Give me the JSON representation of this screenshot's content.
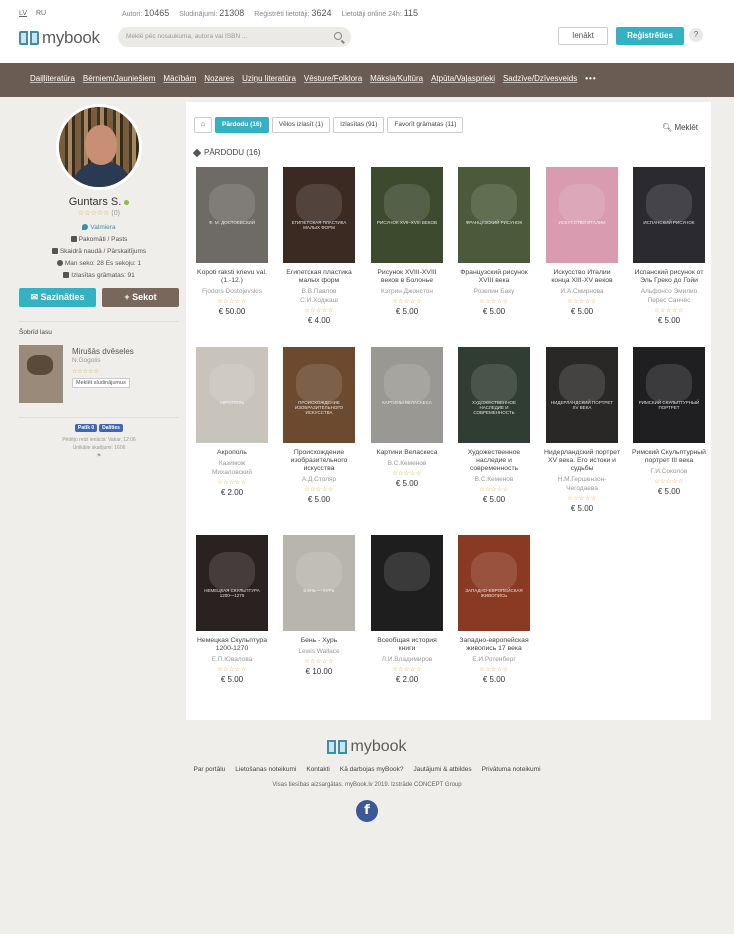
{
  "header": {
    "langs": [
      "LV",
      "RU"
    ],
    "stats": [
      {
        "label": "Autori:",
        "value": "10465"
      },
      {
        "label": "Sludinājumi:",
        "value": "21308"
      },
      {
        "label": "Reģistrēti lietotāji:",
        "value": "3624"
      },
      {
        "label": "Lietotāji online 24h:",
        "value": "115"
      }
    ],
    "logo": "mybook",
    "search_placeholder": "Meklē pēc nosaukuma, autora vai ISBN ...",
    "login": "Ienākt",
    "register": "Reģistrēties",
    "help": "?"
  },
  "nav": [
    "Daiļliteratūra",
    "Bērniem/Jauniešiem",
    "Mācībām",
    "Nozares",
    "Uziņu literatūra",
    "Vēsture/Folklora",
    "Māksla/Kultūra",
    "Atpūta/Vaļasprieki",
    "Sadzīve/Dzīvesveids",
    "•••"
  ],
  "profile": {
    "name": "Guntars S.",
    "stars": "☆☆☆☆☆",
    "rating_count": "(0)",
    "location": "Valmiera",
    "delivery": "Pakomāti / Pasts",
    "payment": "Skaidrā naudā / Pārskaitījums",
    "follow_stats": "Man seko: 28 Es sekoju: 1",
    "fav_stats": "Izlasītas grāmatas: 91",
    "contact_btn": "Sazināties",
    "follow_btn": "Sekot"
  },
  "today": {
    "heading": "Šobrīd lasu",
    "title": "Mirušās dvēseles",
    "author": "N.Gogolis",
    "stars": "☆☆☆☆☆",
    "btn": "Meklēt sludinājumus"
  },
  "social": {
    "fb_like": "Patīk 0",
    "fb_share": "Dalīties",
    "last_visit": "Pēdējo reizi ienācis: Vakar, 12:06",
    "unique_views": "Unikālie skatījumi: 1606",
    "flag": "⚑"
  },
  "tabs": [
    {
      "label": "⌂"
    },
    {
      "label": "Pārdodu (16)"
    },
    {
      "label": "Vēlos izlasīt (1)"
    },
    {
      "label": "Izlasītas (91)"
    },
    {
      "label": "Favorīt grāmatas (11)"
    }
  ],
  "search_link": "Meklēt",
  "section_title": "PĀRDODU (16)",
  "books": [
    {
      "title": "Kopoti raksti krievu val. (1.-12.)",
      "author": "Fjodors Dostojevskis",
      "stars": "☆☆☆☆☆",
      "price": "€ 50.00",
      "color": "#6e6b66",
      "cover_text": "Ф. М. ДОСТОЕВСКИЙ"
    },
    {
      "title": "Египетская пластика малых форм",
      "author": "В.В.Павлов\nС.И.Ходжаш",
      "stars": "☆☆☆☆☆",
      "price": "€ 4.00",
      "color": "#3a2a22",
      "cover_text": "ЕГИПЕТСКАЯ ПЛАСТИКА МАЛЫХ ФОРМ"
    },
    {
      "title": "Рисунок XVIII-XVIII веков в Болонье",
      "author": "Кэтрин Джонстон",
      "stars": "☆☆☆☆☆",
      "price": "€ 5.00",
      "color": "#3d4a2e",
      "cover_text": "РИСУНОК XVII–XVIII ВЕКОВ"
    },
    {
      "title": "Французский рисунок XVIII века",
      "author": "Розелин Баку",
      "stars": "☆☆☆☆☆",
      "price": "€ 5.00",
      "color": "#4a5a3a",
      "cover_text": "ФРАНЦУЗСКИЙ РИСУНОК"
    },
    {
      "title": "Искусство Италии конца XIII-XV веков",
      "author": "И.А.Смирнова",
      "stars": "☆☆☆☆☆",
      "price": "€ 5.00",
      "color": "#d99bb0",
      "cover_text": "ИСКУССТВО ИТАЛИИ"
    },
    {
      "title": "Испанский рисунок от Эль Греко до Гойи",
      "author": "Альфонсо Эмилио\nПерес Санчес",
      "stars": "☆☆☆☆☆",
      "price": "€ 5.00",
      "color": "#2a2a30",
      "cover_text": "ИСПАНСКИЙ РИСУНОК"
    },
    {
      "title": "Акрополь",
      "author": "Казимож\nМихаловский",
      "stars": "☆☆☆☆☆",
      "price": "€ 2.00",
      "color": "#c8c4bc",
      "cover_text": "АКРОПОЛЬ"
    },
    {
      "title": "Происхождение изобразительного искусства",
      "author": "А.Д.Столяр",
      "stars": "☆☆☆☆☆",
      "price": "€ 5.00",
      "color": "#6b4a30",
      "cover_text": "ПРОИСХОЖДЕНИЕ ИЗОБРАЗИТЕЛЬНОГО ИСКУССТВА"
    },
    {
      "title": "Картини Веласкеса",
      "author": "В.С.Кеменов",
      "stars": "☆☆☆☆☆",
      "price": "€ 5.00",
      "color": "#9a9892",
      "cover_text": "КАРТИНЫ ВЕЛАСКЕСА"
    },
    {
      "title": "Художественное наследие и современность",
      "author": "В.С.Кеменов",
      "stars": "☆☆☆☆☆",
      "price": "€ 5.00",
      "color": "#2f3d32",
      "cover_text": "ХУДОЖЕСТВЕННОЕ НАСЛЕДИЕ И СОВРЕМЕННОСТЬ"
    },
    {
      "title": "Нидерландский портрет XV века. Его истоки и судьбы",
      "author": "Н.М.Гершензон-Чегодаева",
      "stars": "☆☆☆☆☆",
      "price": "€ 5.00",
      "color": "#2a2826",
      "cover_text": "НИДЕРЛАНДСКИЙ ПОРТРЕТ XV ВЕКА"
    },
    {
      "title": "Римский Скульптурный портрет III века",
      "author": "Г.И.Соколов",
      "stars": "☆☆☆☆☆",
      "price": "€ 5.00",
      "color": "#1f1f22",
      "cover_text": "РИМСКИЙ СКУЛЬПТУРНЫЙ ПОРТРЕТ"
    },
    {
      "title": "Немецкая Скульптура 1200-1270",
      "author": "Е.П.Ювалова",
      "stars": "☆☆☆☆☆",
      "price": "€ 5.00",
      "color": "#2a2220",
      "cover_text": "НЕМЕЦКАЯ СКУЛЬПТУРА 1200—1270"
    },
    {
      "title": "Бень - Хурь",
      "author": "Lewis Wallace",
      "stars": "☆☆☆☆☆",
      "price": "€ 10.00",
      "color": "#b8b5ac",
      "cover_text": "БЭНЬ — ХУРЬ"
    },
    {
      "title": "Всеобщая история книги",
      "author": "Л.И.Владимиров",
      "stars": "☆☆☆☆☆",
      "price": "€ 2.00",
      "color": "#1e1e1e",
      "cover_text": ""
    },
    {
      "title": "Западно-европейская живопись 17 века",
      "author": "Е.И.Ротенберг",
      "stars": "☆☆☆☆☆",
      "price": "€ 5.00",
      "color": "#8a3a22",
      "cover_text": "ЗАПАДНО-ЕВРОПЕЙСКАЯ ЖИВОПИСЬ"
    }
  ],
  "footer": {
    "logo": "mybook",
    "links": [
      "Par portālu",
      "Lietošanas noteikumi",
      "Kontakti",
      "Kā darbojas myBook?",
      "Jautājumi & atbildes",
      "Privātuma noteikumi"
    ],
    "copyright": "Visas tiesības aizsargātas. myBook.lv 2019. Izstrāde CONCEPT Group",
    "fb": "f"
  }
}
